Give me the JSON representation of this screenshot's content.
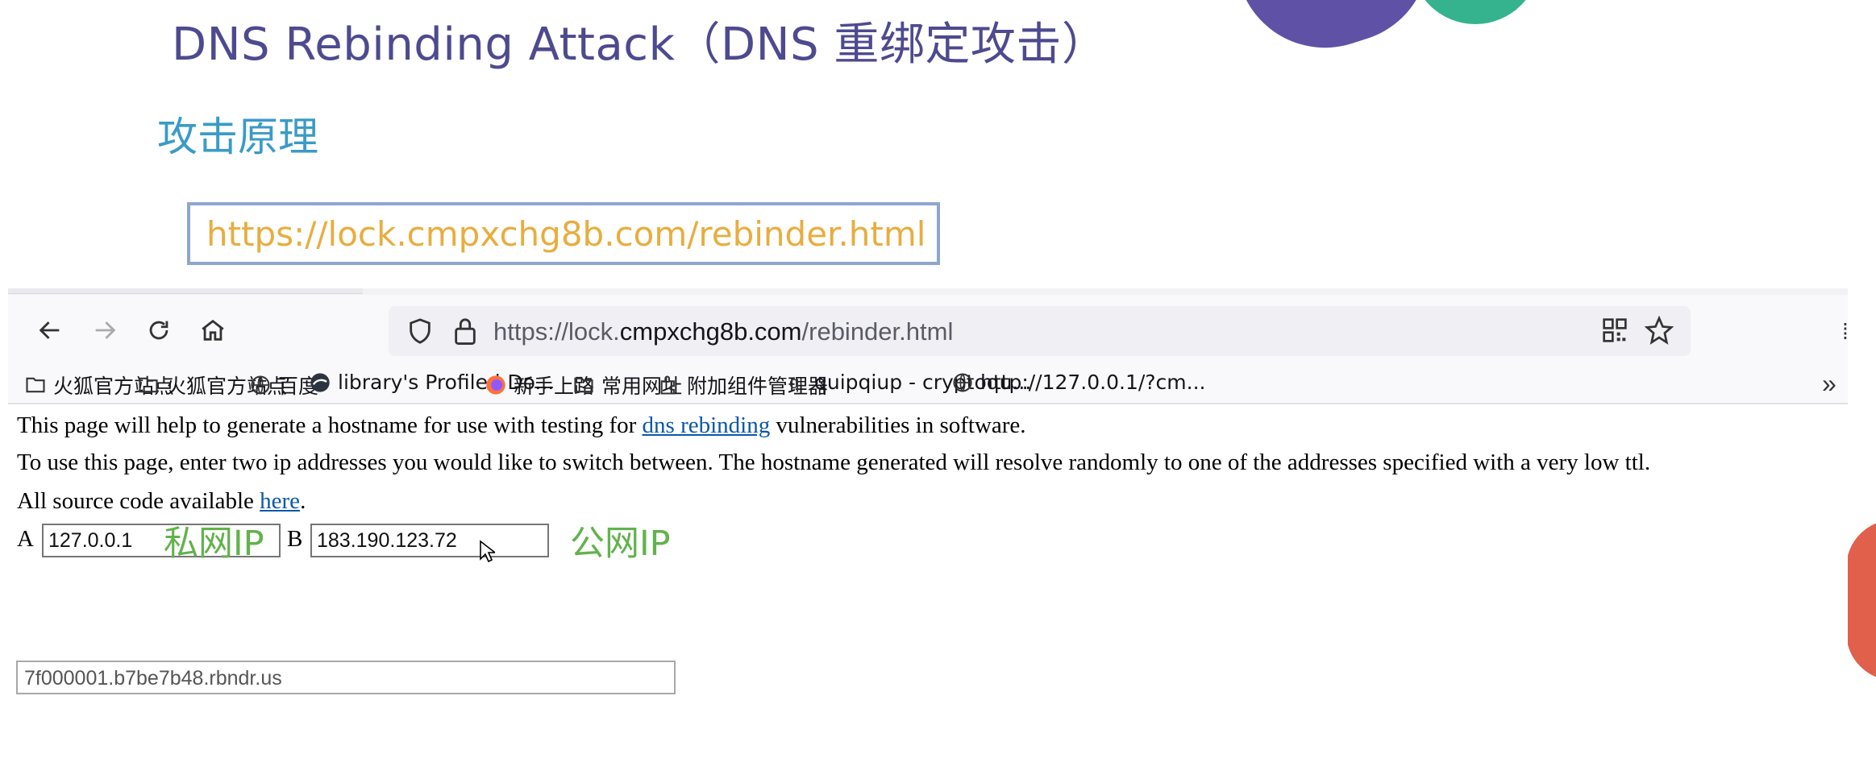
{
  "slide": {
    "title": "DNS Rebinding Attack（DNS 重绑定攻击）",
    "subtitle": "攻击原理",
    "url_callout": "https://lock.cmpxchg8b.com/rebinder.html"
  },
  "browser": {
    "url_prefix": "https://lock.",
    "url_domain": "cmpxchg8b.com",
    "url_path": "/rebinder.html",
    "bookmarks": [
      {
        "icon": "folder-icon",
        "label": "火狐官方站点"
      },
      {
        "icon": "folder-icon",
        "label": "火狐官方站点"
      },
      {
        "icon": "globe-icon",
        "label": "百度"
      },
      {
        "icon": "site-icon",
        "label": "library's Profile | Do..."
      },
      {
        "icon": "firefox-icon",
        "label": "新手上路"
      },
      {
        "icon": "folder-icon",
        "label": "常用网址"
      },
      {
        "icon": "addon-icon",
        "label": "附加组件管理器"
      },
      {
        "icon": "q-icon",
        "label": "quipqiup - cryptoqu..."
      },
      {
        "icon": "globe-icon",
        "label": "http://127.0.0.1/?cm..."
      }
    ]
  },
  "page": {
    "line1_pre": "This page will help to generate a hostname for use with testing for ",
    "line1_link": "dns rebinding",
    "line1_post": " vulnerabilities in software.",
    "line2": "To use this page, enter two ip addresses you would like to switch between. The hostname generated will resolve randomly to one of the addresses specified with a very low ttl.",
    "line3_pre": "All source code available ",
    "line3_link": "here",
    "line3_post": ".",
    "label_a": "A",
    "label_b": "B",
    "ip_a": "127.0.0.1",
    "ip_b": "183.190.123.72",
    "annot_a": "私网IP",
    "annot_b": "公网IP",
    "result": "7f000001.b7be7b48.rbndr.us"
  }
}
